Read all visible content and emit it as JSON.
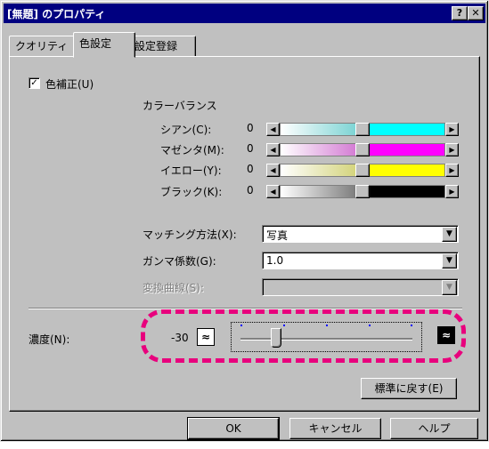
{
  "window": {
    "title": "[無題] のプロパティ",
    "help_btn": "?",
    "close_btn": "✕"
  },
  "tabs": [
    {
      "label": "クオリティ"
    },
    {
      "label": "色設定",
      "active": true
    },
    {
      "label": "設定登録"
    }
  ],
  "color_correction": {
    "checked_mark": "✓",
    "label": "色補正(U)"
  },
  "color_balance": {
    "heading": "カラーバランス",
    "rows": [
      {
        "label": "シアン(C):",
        "value": "0",
        "color": "#00ffff",
        "level": 0.5
      },
      {
        "label": "マゼンタ(M):",
        "value": "0",
        "color": "#ff00ff",
        "level": 0.5
      },
      {
        "label": "イエロー(Y):",
        "value": "0",
        "color": "#ffff00",
        "level": 0.5
      },
      {
        "label": "ブラック(K):",
        "value": "0",
        "color": "#000000",
        "level": 0.5
      }
    ]
  },
  "matching": {
    "label": "マッチング方法(X):",
    "value": "写真"
  },
  "gamma": {
    "label": "ガンマ係数(G):",
    "value": "1.0"
  },
  "curve": {
    "label": "変換曲線(S):",
    "value": ""
  },
  "density": {
    "label": "濃度(N):",
    "value": "-30",
    "level": 0.2,
    "highlight_color": "#e8007d"
  },
  "icons": {
    "light": "light-density-icon",
    "dark": "dark-density-icon"
  },
  "buttons": {
    "reset": "標準に戻す(E)",
    "ok": "OK",
    "cancel": "キャンセル",
    "help": "ヘルプ"
  },
  "arrows": {
    "left": "◀",
    "right": "▶",
    "down": "▼"
  }
}
